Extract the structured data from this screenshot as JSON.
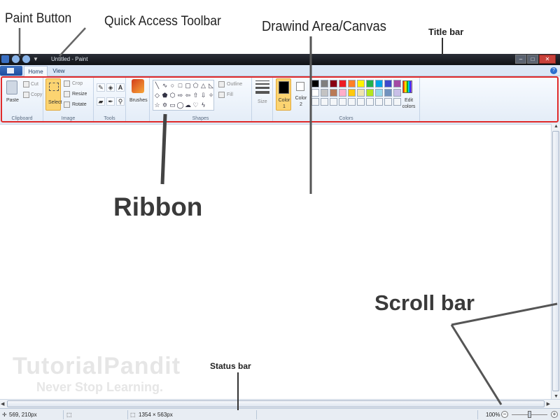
{
  "annotations": {
    "paint_button": "Paint Button",
    "quick_access_toolbar": "Quick Access Toolbar",
    "drawing_area": "Drawind Area/Canvas",
    "title_bar": "Title bar",
    "ribbon": "Ribbon",
    "scroll_bar": "Scroll bar",
    "status_bar": "Status bar"
  },
  "watermark": {
    "brand": "TutorialPandit",
    "tagline": "Never Stop Learning."
  },
  "window": {
    "title": "Untitled - Paint"
  },
  "tabs": [
    "Home",
    "View"
  ],
  "ribbon": {
    "clipboard": {
      "paste": "Paste",
      "cut": "Cut",
      "copy": "Copy",
      "label": "Clipboard"
    },
    "image": {
      "select": "Select",
      "crop": "Crop",
      "resize": "Resize",
      "rotate": "Rotate",
      "label": "Image"
    },
    "tools": {
      "label": "Tools"
    },
    "brushes": {
      "label": "Brushes"
    },
    "shapes": {
      "outline": "Outline",
      "fill": "Fill",
      "label": "Shapes"
    },
    "size": {
      "label": "Size"
    },
    "colors": {
      "color1": "Color 1",
      "color2": "Color 2",
      "edit": "Edit colors",
      "label": "Colors",
      "palette_row1": [
        "#000000",
        "#7f7f7f",
        "#880015",
        "#ed1c24",
        "#ff7f27",
        "#fff200",
        "#22b14c",
        "#00a2e8",
        "#3f48cc",
        "#a349a4"
      ],
      "palette_row2": [
        "#ffffff",
        "#c3c3c3",
        "#b97a57",
        "#ffaec9",
        "#ffc90e",
        "#efe4b0",
        "#b5e61d",
        "#99d9ea",
        "#7092be",
        "#c8bfe7"
      ]
    }
  },
  "status": {
    "cursor_pos": "569, 210px",
    "canvas_size": "1354 × 563px",
    "zoom": "100%"
  }
}
